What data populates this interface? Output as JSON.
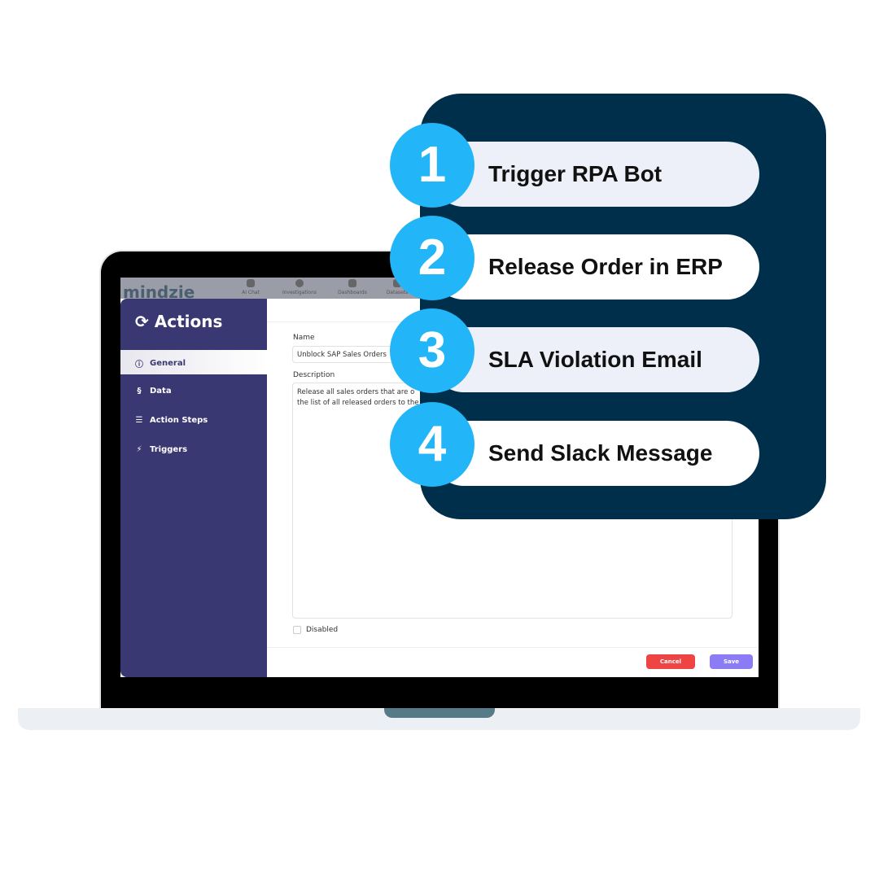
{
  "app": {
    "logo": "mindzie",
    "nav": [
      "AI Chat",
      "Investigations",
      "Dashboards",
      "Datasets"
    ]
  },
  "sidebar": {
    "title": "Actions",
    "items": [
      {
        "label": "General",
        "icon": "info-icon"
      },
      {
        "label": "Data",
        "icon": "data-icon"
      },
      {
        "label": "Action Steps",
        "icon": "sliders-icon"
      },
      {
        "label": "Triggers",
        "icon": "bolt-icon"
      }
    ]
  },
  "form": {
    "name_label": "Name",
    "name_value": "Unblock SAP Sales Orders",
    "description_label": "Description",
    "description_value": "Release all sales orders that are o\nthe list of all released orders to the",
    "disabled_label": "Disabled",
    "cancel": "Cancel",
    "save": "Save"
  },
  "steps": [
    {
      "num": "1",
      "label": "Trigger RPA Bot"
    },
    {
      "num": "2",
      "label": "Release Order in ERP"
    },
    {
      "num": "3",
      "label": "SLA Violation Email"
    },
    {
      "num": "4",
      "label": "Send Slack Message"
    }
  ],
  "colors": {
    "sidebar": "#3A3872",
    "panel": "#002F4B",
    "circle": "#22B5F8",
    "cancel": "#EF4444",
    "save": "#8B7CF6"
  }
}
